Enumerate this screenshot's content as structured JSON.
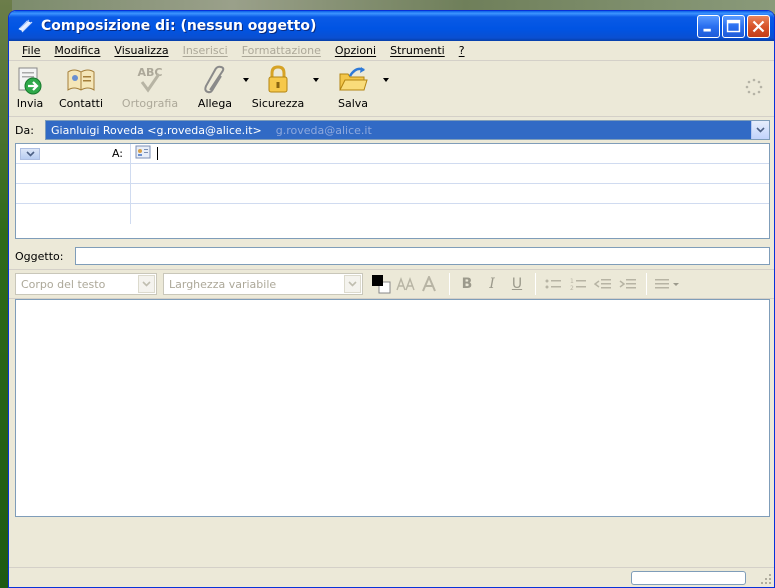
{
  "window": {
    "title": "Composizione di: (nessun oggetto)"
  },
  "menu": [
    {
      "label": "File",
      "enabled": true
    },
    {
      "label": "Modifica",
      "enabled": true
    },
    {
      "label": "Visualizza",
      "enabled": true
    },
    {
      "label": "Inserisci",
      "enabled": false
    },
    {
      "label": "Formattazione",
      "enabled": false
    },
    {
      "label": "Opzioni",
      "enabled": true
    },
    {
      "label": "Strumenti",
      "enabled": true
    },
    {
      "label": "?",
      "enabled": true
    }
  ],
  "toolbar": {
    "send": "Invia",
    "contacts": "Contatti",
    "spelling": "Ortografia",
    "attach": "Allega",
    "security": "Sicurezza",
    "save": "Salva",
    "spelling_icon_text": "ABC"
  },
  "from": {
    "label": "Da:",
    "value": "Gianluigi Roveda <g.roveda@alice.it>",
    "ghost": "g.roveda@alice.it"
  },
  "recipients": {
    "type": "A:",
    "value": ""
  },
  "subject": {
    "label": "Oggetto:",
    "value": ""
  },
  "format": {
    "paragraph_style": "Corpo del testo",
    "font": "Larghezza variabile"
  },
  "colors": {
    "title_blue": "#0054e3",
    "selection_blue": "#316ac5",
    "face": "#ece9d8"
  }
}
